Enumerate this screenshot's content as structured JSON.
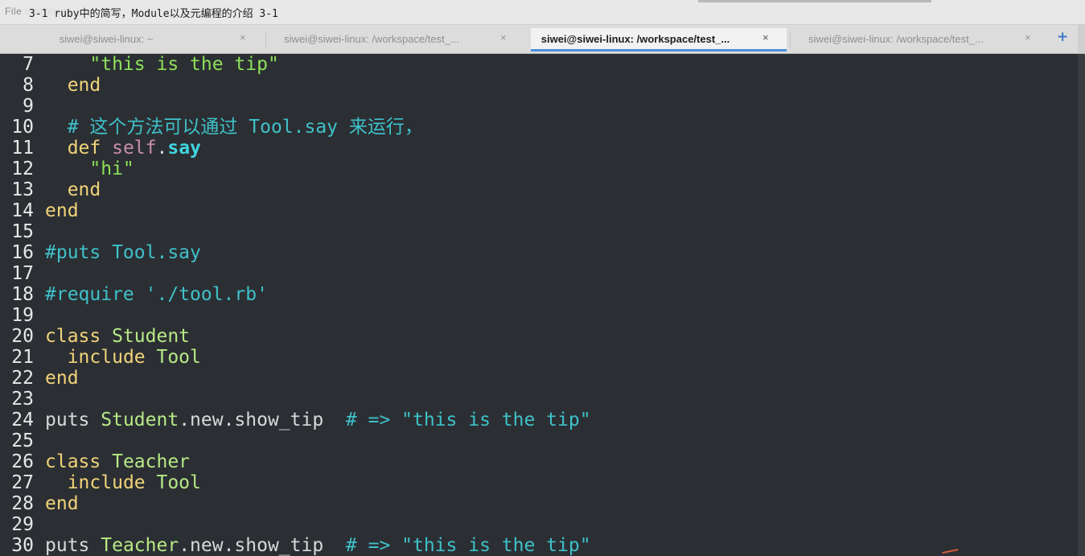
{
  "menubar": {
    "ghost_text": "File   Edit   View",
    "video_title": "3-1 ruby中的简写，Module以及元编程的介绍 3-1"
  },
  "tabs": [
    {
      "label": "siwei@siwei-linux: ~",
      "active": false
    },
    {
      "label": "siwei@siwei-linux: /workspace/test_...",
      "active": false
    },
    {
      "label": "siwei@siwei-linux: /workspace/test_...",
      "active": true
    },
    {
      "label": "siwei@siwei-linux: /workspace/test_...",
      "active": false
    }
  ],
  "tab_close_glyph": "×",
  "add_tab_glyph": "+",
  "colors": {
    "keyword": "#f1d37a",
    "string": "#8ee05a",
    "comment": "#3fc1c9",
    "constant": "#b8e986",
    "editor_bg": "#2b2f33",
    "active_tab_underline": "#4a90d9"
  },
  "lines": [
    {
      "n": "7",
      "tokens": [
        {
          "t": "    ",
          "c": "plain"
        },
        {
          "t": "\"this is the tip\"",
          "c": "str"
        }
      ]
    },
    {
      "n": "8",
      "tokens": [
        {
          "t": "  ",
          "c": "plain"
        },
        {
          "t": "end",
          "c": "kw"
        }
      ]
    },
    {
      "n": "9",
      "tokens": []
    },
    {
      "n": "10",
      "tokens": [
        {
          "t": "  ",
          "c": "plain"
        },
        {
          "t": "# 这个方法可以通过 Tool.say 来运行，",
          "c": "cm"
        }
      ]
    },
    {
      "n": "11",
      "tokens": [
        {
          "t": "  ",
          "c": "plain"
        },
        {
          "t": "def ",
          "c": "kw"
        },
        {
          "t": "self",
          "c": "self"
        },
        {
          "t": ".",
          "c": "plain"
        },
        {
          "t": "say",
          "c": "meth"
        }
      ]
    },
    {
      "n": "12",
      "tokens": [
        {
          "t": "    ",
          "c": "plain"
        },
        {
          "t": "\"hi\"",
          "c": "str"
        }
      ]
    },
    {
      "n": "13",
      "tokens": [
        {
          "t": "  ",
          "c": "plain"
        },
        {
          "t": "end",
          "c": "kw"
        }
      ]
    },
    {
      "n": "14",
      "tokens": [
        {
          "t": "end",
          "c": "kw"
        }
      ]
    },
    {
      "n": "15",
      "tokens": []
    },
    {
      "n": "16",
      "tokens": [
        {
          "t": "#puts Tool.say",
          "c": "cm"
        }
      ]
    },
    {
      "n": "17",
      "tokens": []
    },
    {
      "n": "18",
      "tokens": [
        {
          "t": "#require './tool.rb'",
          "c": "cm"
        }
      ]
    },
    {
      "n": "19",
      "tokens": []
    },
    {
      "n": "20",
      "tokens": [
        {
          "t": "class ",
          "c": "kw"
        },
        {
          "t": "Student",
          "c": "const"
        }
      ]
    },
    {
      "n": "21",
      "tokens": [
        {
          "t": "  ",
          "c": "plain"
        },
        {
          "t": "include ",
          "c": "kw"
        },
        {
          "t": "Tool",
          "c": "const"
        }
      ]
    },
    {
      "n": "22",
      "tokens": [
        {
          "t": "end",
          "c": "kw"
        }
      ]
    },
    {
      "n": "23",
      "tokens": []
    },
    {
      "n": "24",
      "tokens": [
        {
          "t": "puts ",
          "c": "plain"
        },
        {
          "t": "Student",
          "c": "const"
        },
        {
          "t": ".new.show_tip  ",
          "c": "plain"
        },
        {
          "t": "# => \"this is the tip\"",
          "c": "cm"
        }
      ]
    },
    {
      "n": "25",
      "tokens": []
    },
    {
      "n": "26",
      "tokens": [
        {
          "t": "class ",
          "c": "kw"
        },
        {
          "t": "Teacher",
          "c": "const"
        }
      ]
    },
    {
      "n": "27",
      "tokens": [
        {
          "t": "  ",
          "c": "plain"
        },
        {
          "t": "include ",
          "c": "kw"
        },
        {
          "t": "Tool",
          "c": "const"
        }
      ]
    },
    {
      "n": "28",
      "tokens": [
        {
          "t": "end",
          "c": "kw"
        }
      ]
    },
    {
      "n": "29",
      "tokens": []
    },
    {
      "n": "30",
      "tokens": [
        {
          "t": "puts ",
          "c": "plain"
        },
        {
          "t": "Teacher",
          "c": "const"
        },
        {
          "t": ".new.show_tip  ",
          "c": "plain"
        },
        {
          "t": "# => \"this is the tip\"",
          "c": "cm"
        }
      ]
    }
  ]
}
